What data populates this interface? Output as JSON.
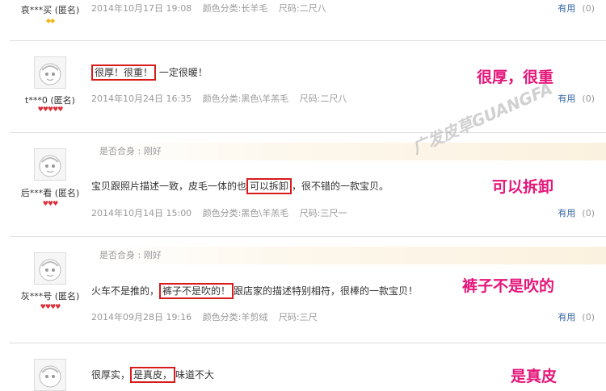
{
  "reviews": [
    {
      "user": "哀***买 (匿名)",
      "rank_color": "#f2b41b",
      "rank_count": 2,
      "date": "2014年10月17日 19:08",
      "color_label": "颜色分类:长羊毛",
      "size_label": "尺码:二尺八",
      "useful_label": "有用",
      "useful_count": "(0)"
    },
    {
      "user": "t***0 (匿名)",
      "rank_color": "#d9303a",
      "rank_count": 5,
      "content_highlight": "很厚！很重！",
      "content_after": "一定很暖！",
      "date": "2014年10月24日 16:35",
      "color_label": "颜色分类:黑色\\羊羔毛",
      "size_label": "尺码:二尺八",
      "useful_label": "有用",
      "useful_count": "(0)",
      "callout": "很厚，很重"
    },
    {
      "user": "后***看 (匿名)",
      "rank_color": "#d9303a",
      "rank_count": 3,
      "fit_label": "是否合身  :  刚好",
      "content_before": "宝贝跟照片描述一致，皮毛一体的也",
      "content_highlight": "可以拆卸",
      "content_after": "，很不错的一款宝贝。",
      "date": "2014年10月14日 15:00",
      "color_label": "颜色分类:黑色\\羊羔毛",
      "size_label": "尺码:三尺一",
      "useful_label": "有用",
      "useful_count": "(0)",
      "callout": "可以拆卸"
    },
    {
      "user": "灰***号 (匿名)",
      "rank_color": "#d9303a",
      "rank_count": 4,
      "fit_label": "是否合身  :  刚好",
      "content_before": "火车不是推的，",
      "content_highlight": "裤子不是吹的！",
      "content_after": "跟店家的描述特别相符，很棒的一款宝贝！",
      "date": "2014年09月28日 19:16",
      "color_label": "颜色分类:羊剪绒",
      "size_label": "尺码:三尺",
      "useful_label": "有用",
      "useful_count": "(0)",
      "callout": "裤子不是吹的"
    },
    {
      "content_before": "很厚实，",
      "content_highlight": "是真皮，",
      "content_after": "味道不大",
      "callout": "是真皮"
    }
  ],
  "watermark": "广发皮草GUANGFA",
  "icons": {
    "avatar": "default-avatar-icon",
    "gem": "heart-gem-icon"
  }
}
